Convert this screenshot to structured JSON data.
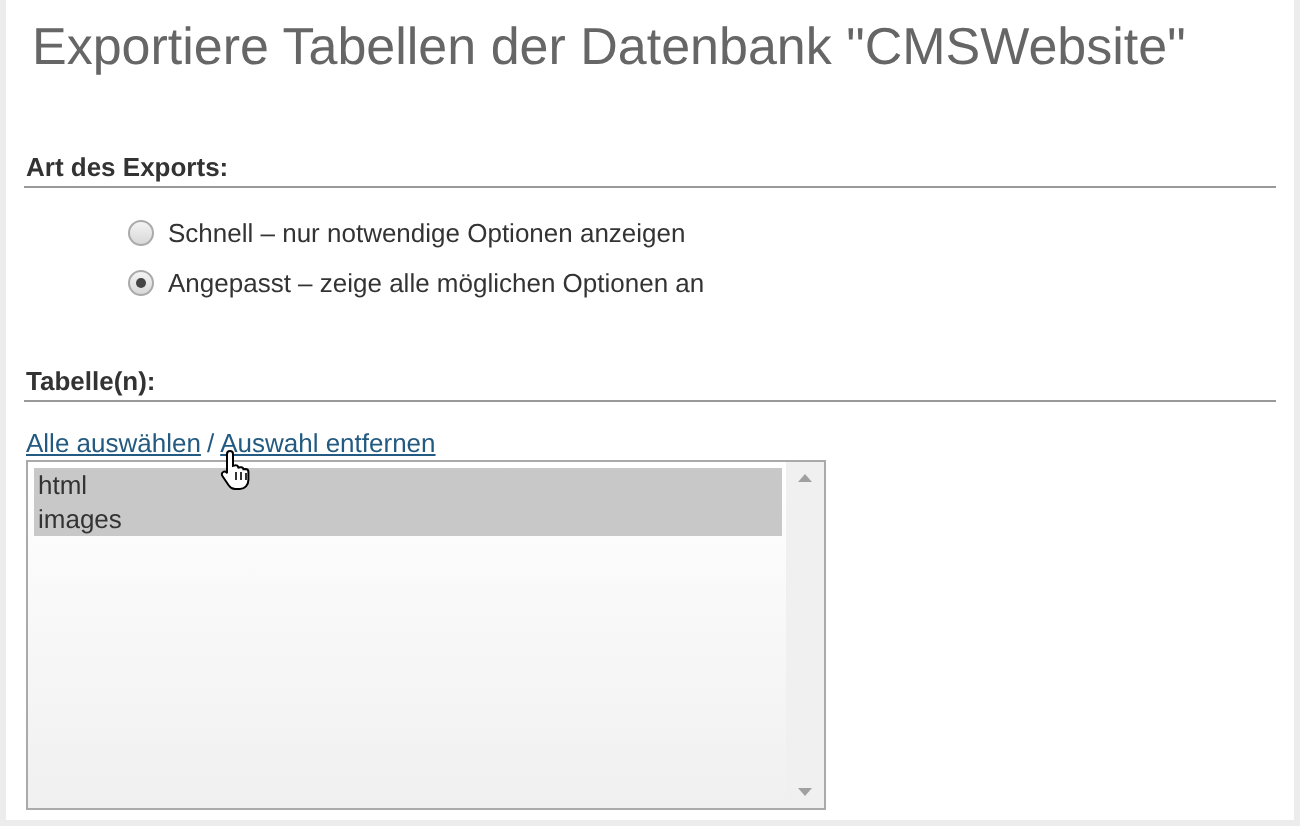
{
  "title": "Exportiere Tabellen der Datenbank \"CMSWebsite\"",
  "export_type": {
    "heading": "Art des Exports:",
    "options": [
      {
        "label": "Schnell – nur notwendige Optionen anzeigen",
        "selected": false
      },
      {
        "label": "Angepasst – zeige alle möglichen Optionen an",
        "selected": true
      }
    ]
  },
  "tables": {
    "heading": "Tabelle(n):",
    "select_all": "Alle auswählen",
    "separator": "/",
    "deselect_all": "Auswahl entfernen",
    "items": [
      {
        "label": "html",
        "selected": true
      },
      {
        "label": "images",
        "selected": true
      }
    ]
  }
}
